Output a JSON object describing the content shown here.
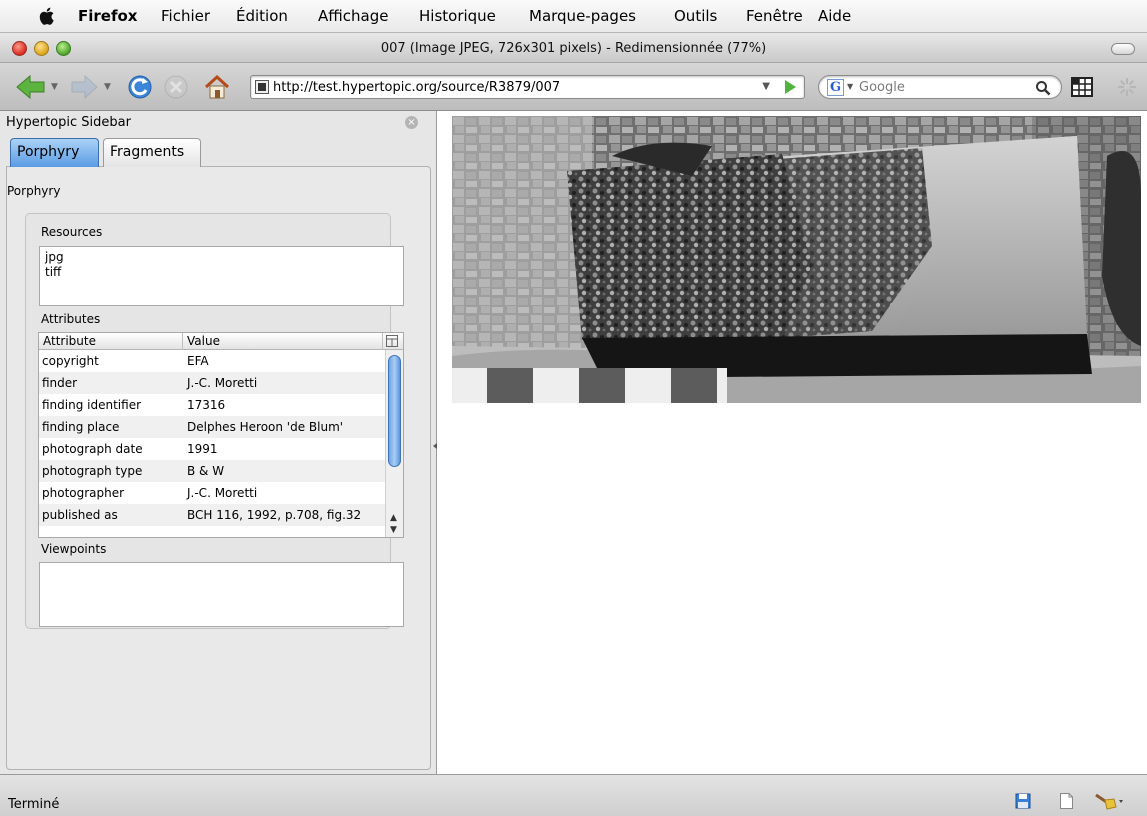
{
  "menubar": {
    "items": [
      "Firefox",
      "Fichier",
      "Édition",
      "Affichage",
      "Historique",
      "Marque-pages",
      "Outils",
      "Fenêtre",
      "Aide"
    ]
  },
  "window": {
    "title": "007 (Image JPEG, 726x301 pixels) - Redimensionnée (77%)"
  },
  "navbar": {
    "url": "http://test.hypertopic.org/source/R3879/007",
    "search_placeholder": "Google",
    "search_engine_glyph": "G"
  },
  "sidebar": {
    "header": "Hypertopic Sidebar",
    "close_glyph": "×",
    "tabs": [
      {
        "label": "Porphyry",
        "selected": true
      },
      {
        "label": "Fragments",
        "selected": false
      }
    ],
    "panel_title": "Porphyry",
    "resources": {
      "label": "Resources",
      "items": [
        "jpg",
        "tiff"
      ]
    },
    "attributes": {
      "label": "Attributes",
      "columns": [
        "Attribute",
        "Value"
      ],
      "rows": [
        {
          "attribute": "copyright",
          "value": "EFA"
        },
        {
          "attribute": "finder",
          "value": "J.-C. Moretti"
        },
        {
          "attribute": "finding identifier",
          "value": "17316"
        },
        {
          "attribute": "finding place",
          "value": "Delphes Heroon 'de Blum'"
        },
        {
          "attribute": "photograph date",
          "value": "1991"
        },
        {
          "attribute": "photograph type",
          "value": "B & W"
        },
        {
          "attribute": "photographer",
          "value": "J.-C. Moretti"
        },
        {
          "attribute": "published as",
          "value": "BCH 116, 1992, p.708, fig.32"
        }
      ]
    },
    "viewpoints": {
      "label": "Viewpoints"
    }
  },
  "statusbar": {
    "text": "Terminé"
  },
  "icons": {
    "apple": "apple-logo-icon",
    "back": "back-arrow-icon",
    "forward": "forward-arrow-icon",
    "reload": "reload-icon",
    "stop": "stop-icon",
    "home": "home-icon",
    "go": "go-arrow-icon",
    "search": "magnifier-icon",
    "grid": "grid-icon",
    "throbber": "activity-throbber-icon",
    "save": "floppy-disk-icon",
    "page": "page-icon",
    "broom": "broom-icon"
  },
  "colors": {
    "tab_selected": "#5a9be4",
    "scroll_thumb": "#6ea5e8",
    "go_arrow": "#4fb43c",
    "back_arrow": "#5cb33f"
  }
}
